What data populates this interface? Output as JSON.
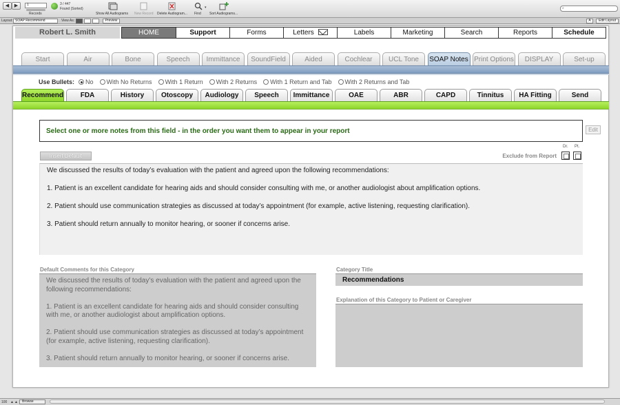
{
  "toolbar": {
    "record_value": "1",
    "records_label": "Records",
    "count_text": "3 / 447",
    "found_text": "Found (Sorted)",
    "show_all_label": "Show All Audiograms",
    "new_record_label": "New Record",
    "delete_label": "Delete Audiogram...",
    "find_label": "Find",
    "sort_label": "Sort Audiograms...",
    "search_placeholder": "",
    "font_size_label": "A",
    "edit_layout_label": "Edit Layout"
  },
  "layoutbar": {
    "layout_label": "Layout:",
    "layout_value": "SOAP Recommend",
    "view_as_label": "View As:",
    "preview_label": "Preview"
  },
  "header": {
    "patient_name": "Robert L. Smith"
  },
  "topnav": [
    {
      "label": "HOME"
    },
    {
      "label": "Support"
    },
    {
      "label": "Forms"
    },
    {
      "label": "Letters"
    },
    {
      "label": "Labels"
    },
    {
      "label": "Marketing"
    },
    {
      "label": "Search"
    },
    {
      "label": "Reports"
    },
    {
      "label": "Schedule"
    }
  ],
  "testtabs": [
    {
      "label": "Start"
    },
    {
      "label": "Air"
    },
    {
      "label": "Bone"
    },
    {
      "label": "Speech"
    },
    {
      "label": "Immittance"
    },
    {
      "label": "SoundField"
    },
    {
      "label": "Aided"
    },
    {
      "label": "Cochlear"
    },
    {
      "label": "UCL Tone"
    },
    {
      "label": "SOAP Notes"
    },
    {
      "label": "Print Options"
    },
    {
      "label": "DISPLAY"
    },
    {
      "label": "Set-up"
    }
  ],
  "bullets": {
    "label": "Use Bullets:",
    "options": [
      "No",
      "With No Returns",
      "With 1 Return",
      "With 2 Returns",
      "With 1 Return and Tab",
      "With 2 Returns and Tab"
    ]
  },
  "soaptabs": [
    {
      "label": "Recommend"
    },
    {
      "label": "FDA"
    },
    {
      "label": "History"
    },
    {
      "label": "Otoscopy"
    },
    {
      "label": "Audiology"
    },
    {
      "label": "Speech"
    },
    {
      "label": "Immittance"
    },
    {
      "label": "OAE"
    },
    {
      "label": "ABR"
    },
    {
      "label": "CAPD"
    },
    {
      "label": "Tinnitus"
    },
    {
      "label": "HA Fitting"
    },
    {
      "label": "Send"
    }
  ],
  "main": {
    "prompt": "Select one or more notes from this field -  in the order you want them to appear in your report",
    "edit_label": "Edit",
    "insert_default_label": "Insert Default",
    "exclude_label": "Exclude from Report",
    "dr_label": "Dr.",
    "pt_label": "Pt.",
    "notes": [
      "We discussed the results of today’s evaluation with the patient and agreed upon the following recommendations:",
      "1. Patient is an excellent candidate for hearing aids and should consider consulting with me, or another audiologist about amplification options.",
      "2. Patient should use communication strategies as discussed at today’s appointment (for example, active listening, requesting clarification).",
      "3. Patient should return annually to monitor hearing, or sooner if concerns arise."
    ],
    "default_comments_label": "Default Comments for this Category",
    "default_comments": [
      "We discussed the results of today’s evaluation with the patient and agreed upon the following recommendations:",
      "1. Patient is an excellent candidate for hearing aids and should consider consulting with me, or another audiologist about amplification options.",
      "2. Patient should use communication strategies as discussed at today’s appointment (for example, active listening, requesting clarification).",
      "3. Patient should return annually to monitor hearing, or sooner if concerns arise."
    ],
    "category_title_label": "Category Title",
    "category_title": "Recommendations",
    "explanation_label": "Explanation of this Category to Patient or Caregiver",
    "explanation": ""
  },
  "statusbar": {
    "zoom": "100",
    "mode": "Browse"
  },
  "colors": {
    "active_soap_tab": "#9ee03a",
    "active_test_tab": "#c8d8ea",
    "prompt_text": "#2a6a16",
    "home_tab": "#7a7a7a"
  }
}
